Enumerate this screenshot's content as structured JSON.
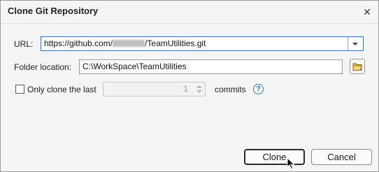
{
  "dialog": {
    "title": "Clone Git Repository",
    "close_icon": "close-icon"
  },
  "url": {
    "label": "URL:",
    "value_prefix": "https://github.com/",
    "value_suffix": "/TeamUtilities.git",
    "dropdown_icon": "chevron-down-icon"
  },
  "folder": {
    "label": "Folder location:",
    "value": "C:\\WorkSpace\\TeamUtilities",
    "browse_icon": "folder-icon"
  },
  "depth": {
    "checkbox_label": "Only clone the last",
    "checked": false,
    "value": "1",
    "suffix": "commits",
    "help_icon": "help-icon",
    "help_glyph": "?"
  },
  "buttons": {
    "clone_label": "Clone",
    "cancel_label": "Cancel"
  }
}
